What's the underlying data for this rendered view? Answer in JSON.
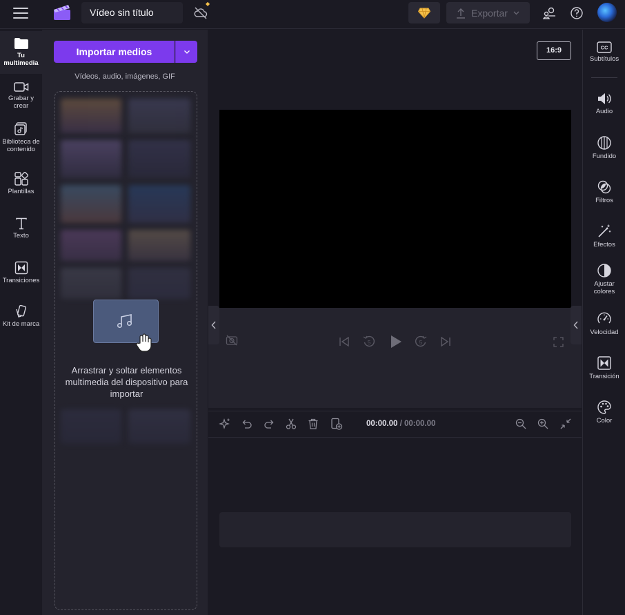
{
  "header": {
    "project_title": "Vídeo sin título",
    "export_label": "Exportar",
    "accent_color": "#7c3aed",
    "premium_color": "#f5c04a"
  },
  "leftnav": {
    "items": [
      {
        "label": "Tu multimedia",
        "icon": "folder-icon",
        "active": true
      },
      {
        "label": "Grabar y crear",
        "icon": "camera-icon"
      },
      {
        "label": "Biblioteca de contenido",
        "icon": "library-icon"
      },
      {
        "label": "Plantillas",
        "icon": "templates-icon"
      },
      {
        "label": "Texto",
        "icon": "text-icon"
      },
      {
        "label": "Transiciones",
        "icon": "transitions-icon"
      },
      {
        "label": "Kit de marca",
        "icon": "brand-kit-icon"
      }
    ]
  },
  "media": {
    "import_label": "Importar medios",
    "import_hint": "Vídeos, audio, imágenes, GIF",
    "drop_text": "Arrastrar y soltar elementos multimedia del dispositivo para importar"
  },
  "stage": {
    "aspect_ratio": "16:9"
  },
  "timeline": {
    "current_time": "00:00.00",
    "total_time": "/ 00:00.00"
  },
  "rightnav": {
    "items": [
      {
        "label": "Subtítulos",
        "icon": "captions-icon"
      },
      {
        "label": "Audio",
        "icon": "audio-icon"
      },
      {
        "label": "Fundido",
        "icon": "fade-icon"
      },
      {
        "label": "Filtros",
        "icon": "filters-icon"
      },
      {
        "label": "Efectos",
        "icon": "effects-icon"
      },
      {
        "label": "Ajustar colores",
        "icon": "adjust-colors-icon"
      },
      {
        "label": "Velocidad",
        "icon": "speed-icon"
      },
      {
        "label": "Transición",
        "icon": "transition-icon"
      },
      {
        "label": "Color",
        "icon": "color-palette-icon"
      }
    ]
  }
}
